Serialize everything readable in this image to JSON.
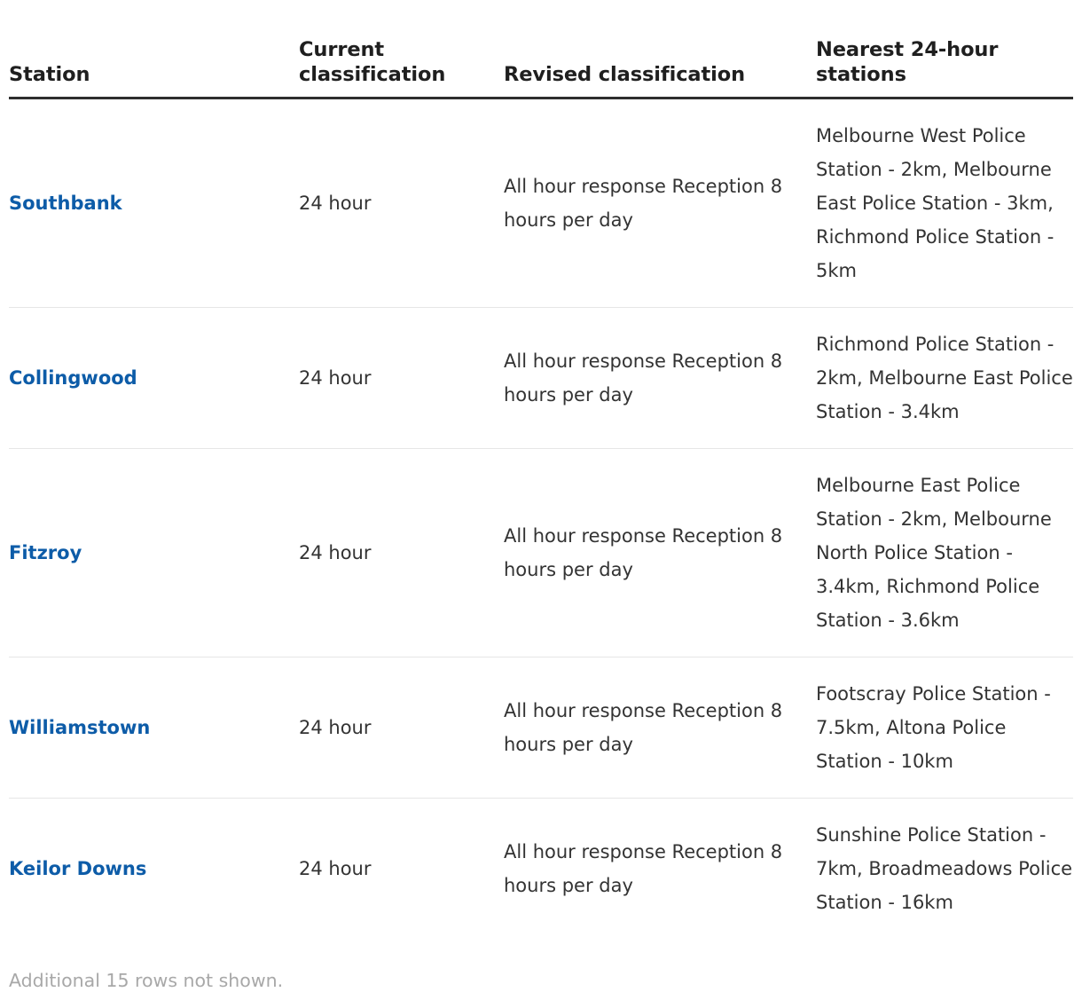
{
  "table": {
    "columns": [
      {
        "key": "station",
        "label": "Station"
      },
      {
        "key": "current",
        "label": "Current classification"
      },
      {
        "key": "revised",
        "label": "Revised classification"
      },
      {
        "key": "nearest",
        "label": "Nearest 24-hour stations"
      }
    ],
    "rows": [
      {
        "station": "Southbank",
        "current": "24 hour",
        "revised": "All hour response Reception 8 hours per day",
        "nearest": "Melbourne West Police Station - 2km, Melbourne East Police Station - 3km, Richmond Police Station - 5km"
      },
      {
        "station": "Collingwood",
        "current": "24 hour",
        "revised": "All hour response Reception 8 hours per day",
        "nearest": "Richmond Police Station - 2km, Melbourne East Police Station - 3.4km"
      },
      {
        "station": "Fitzroy",
        "current": "24 hour",
        "revised": "All hour response Reception 8 hours per day",
        "nearest": "Melbourne East Police Station - 2km, Melbourne North Police Station - 3.4km, Richmond Police Station - 3.6km"
      },
      {
        "station": "Williamstown",
        "current": "24 hour",
        "revised": "All hour response Reception 8 hours per day",
        "nearest": "Footscray Police Station - 7.5km, Altona Police Station - 10km"
      },
      {
        "station": "Keilor Downs",
        "current": "24 hour",
        "revised": "All hour response Reception 8 hours per day",
        "nearest": "Sunshine Police Station - 7km, Broadmeadows Police Station - 16km"
      }
    ]
  },
  "footer": {
    "truncation_note": "Additional 15 rows not shown."
  },
  "colors": {
    "link": "#0d5ca8",
    "header_text": "#1f1f1f",
    "body_text": "#333333",
    "header_rule": "#2e2e2e",
    "row_rule": "#e6e6e6",
    "muted_text": "#a8a8a8",
    "background": "#ffffff"
  }
}
